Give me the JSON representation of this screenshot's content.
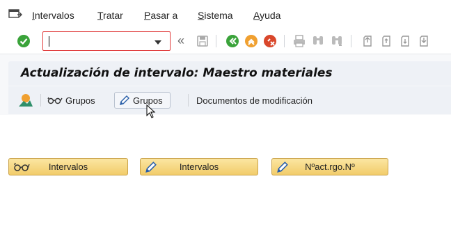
{
  "menubar": {
    "items": [
      {
        "label": "Intervalos",
        "underline": "I",
        "rest": "ntervalos"
      },
      {
        "label": "Tratar",
        "underline": "T",
        "rest": "ratar"
      },
      {
        "label": "Pasar a",
        "underline": "P",
        "rest": "asar a"
      },
      {
        "label": "Sistema",
        "underline": "S",
        "rest": "istema"
      },
      {
        "label": "Ayuda",
        "underline": "A",
        "rest": "yuda"
      }
    ]
  },
  "toolbar": {
    "command_field_value": "",
    "collapse_glyph": "«"
  },
  "title": "Actualización de intervalo: Maestro materiales",
  "app_toolbar": {
    "groups_display_label": "Grupos",
    "groups_edit_label": "Grupos",
    "change_docs_label": "Documentos de modificación"
  },
  "content": {
    "intervals_display_label": "Intervalos",
    "intervals_edit_label": "Intervalos",
    "current_number_label": "Nºact.rgo.Nº"
  },
  "colors": {
    "accent_green": "#3aa33a",
    "accent_orange": "#f0a030",
    "accent_red": "#d9472b",
    "button_yellow": "#f6d37a"
  }
}
